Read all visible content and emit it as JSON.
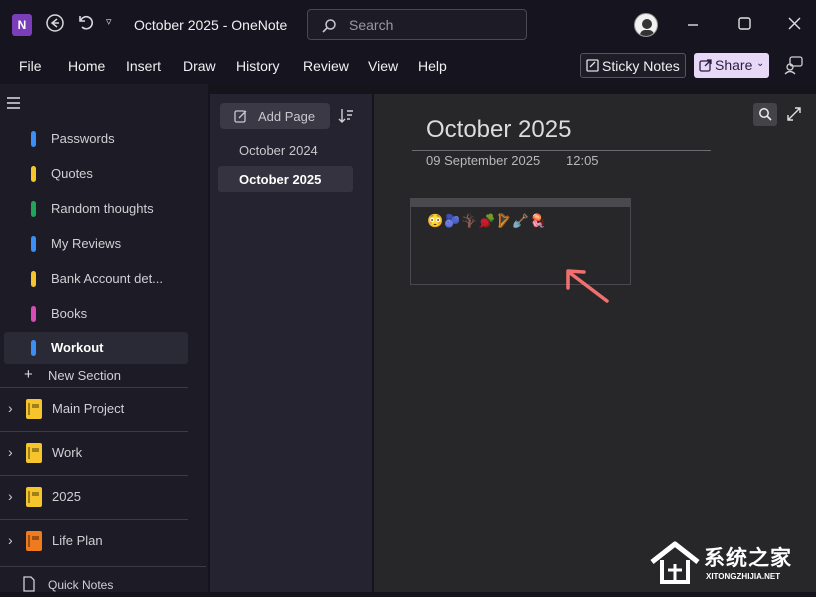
{
  "titlebar": {
    "title": "October 2025 - OneNote",
    "app_icon": "N",
    "search_placeholder": "Search"
  },
  "menu": [
    "File",
    "Home",
    "Insert",
    "Draw",
    "History",
    "Review",
    "View",
    "Help"
  ],
  "toolbar": {
    "sticky_notes": "Sticky Notes",
    "share": "Share"
  },
  "sections": [
    {
      "label": "Passwords",
      "color": "#3b8ef5"
    },
    {
      "label": "Quotes",
      "color": "#f5c52b"
    },
    {
      "label": "Random thoughts",
      "color": "#1fa35d"
    },
    {
      "label": "My Reviews",
      "color": "#3b8ef5"
    },
    {
      "label": "Bank Account det...",
      "color": "#f5c52b"
    },
    {
      "label": "Books",
      "color": "#d94bb8"
    },
    {
      "label": "Workout",
      "color": "#3b8ef5"
    }
  ],
  "new_section": "New Section",
  "notebooks": [
    {
      "label": "Main Project",
      "color": "#f5c52b"
    },
    {
      "label": "Work",
      "color": "#f5c52b"
    },
    {
      "label": "2025",
      "color": "#f5c52b"
    },
    {
      "label": "Life Plan",
      "color": "#f07a1e"
    }
  ],
  "quick_notes": "Quick Notes",
  "pages": {
    "add_page": "Add Page",
    "items": [
      "October 2024",
      "October 2025"
    ]
  },
  "page": {
    "title": "October 2025",
    "date": "09 September 2025",
    "time": "12:05",
    "note_content": "😳🫐🪾🫜🪉🪏🪼"
  },
  "watermark": {
    "name": "系统之家",
    "site": "XITONGZHIJIA.NET"
  }
}
